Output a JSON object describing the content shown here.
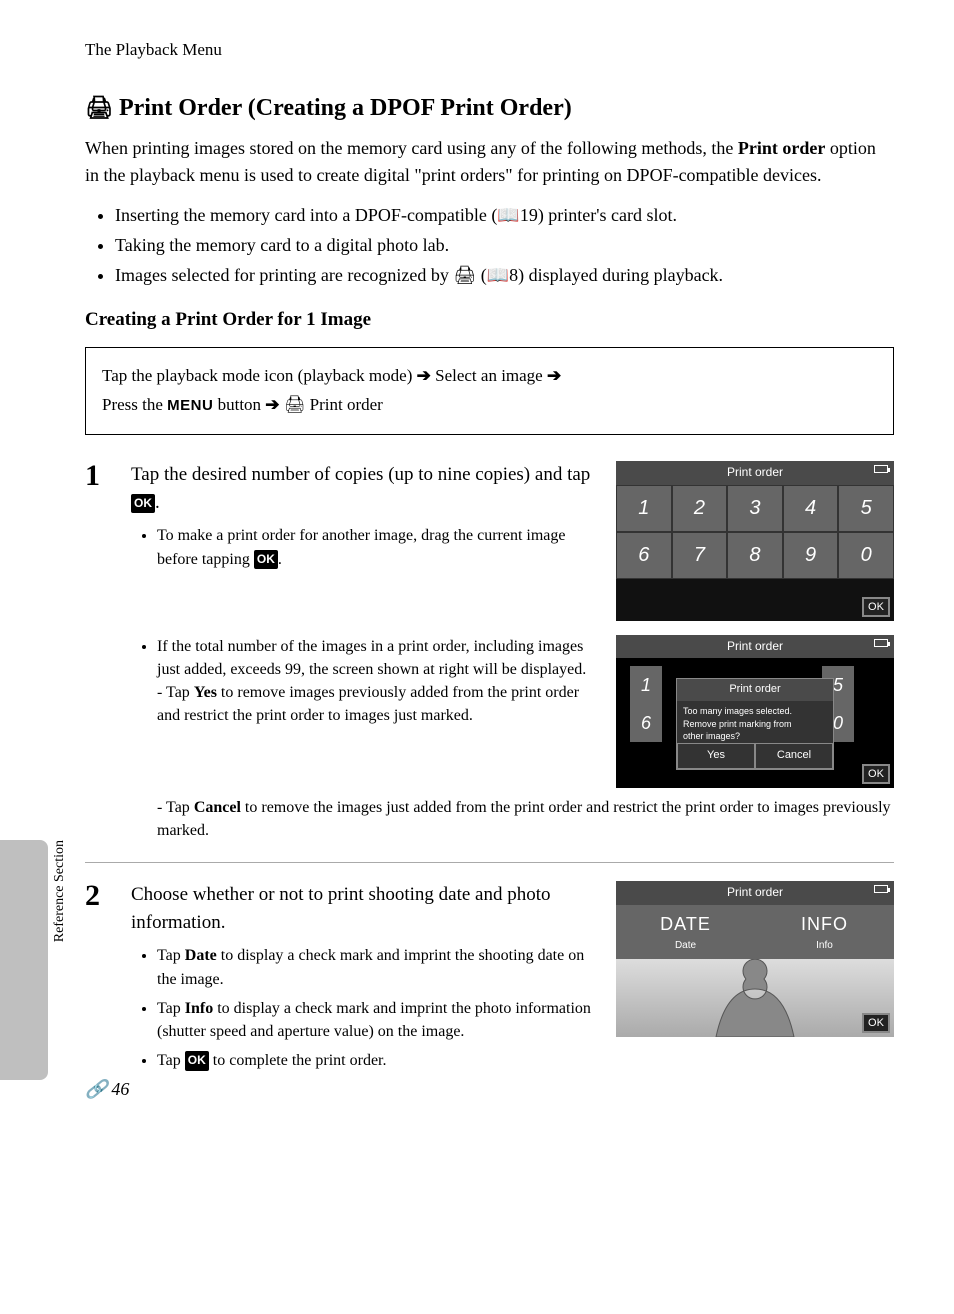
{
  "header": {
    "section": "The Playback Menu"
  },
  "title": "Print Order (Creating a DPOF Print Order)",
  "intro": {
    "part1": "When printing images stored on the memory card using any of the following methods, the ",
    "bold": "Print order",
    "part2": " option in the playback menu is used to create digital \"print orders\" for printing on DPOF-compatible devices."
  },
  "bullets": [
    "Inserting the memory card into a DPOF-compatible (📖19) printer's card slot.",
    "Taking the memory card to a digital photo lab.",
    "Images selected for printing are recognized by 🖨 (📖8) displayed during playback."
  ],
  "subhead": "Creating a Print Order for 1 Image",
  "navbox": {
    "l1a": "Tap the playback mode icon (playback mode) ",
    "l1b": " Select an image ",
    "l2a": "Press the ",
    "l2menu": "MENU",
    "l2b": " button ",
    "l2c": " 🖨 Print order"
  },
  "step1": {
    "head_a": "Tap the desired number of copies (up to nine copies) and tap ",
    "head_b": ".",
    "sub1": "To make a print order for another image, drag the current image before tapping ",
    "sub2": "If the total number of the images in a print order, including images just added, exceeds 99, the screen shown at right will be displayed.",
    "yes_a": "Tap ",
    "yes_b": "Yes",
    "yes_c": " to remove images previously added from the print order and restrict the print order to images just marked.",
    "cancel_a": "Tap ",
    "cancel_b": "Cancel",
    "cancel_c": " to remove the images just added from the print order and restrict the print order to images previously marked."
  },
  "step2": {
    "head": "Choose whether or not to print shooting date and photo information.",
    "b1a": "Tap ",
    "b1b": "Date",
    "b1c": " to display a check mark and imprint the shooting date on the image.",
    "b2a": "Tap ",
    "b2b": "Info",
    "b2c": " to display a check mark and imprint the photo information (shutter speed and aperture value) on the image.",
    "b3a": "Tap ",
    "b3b": " to complete the print order."
  },
  "screen1": {
    "title": "Print order",
    "keys": [
      "1",
      "2",
      "3",
      "4",
      "5",
      "6",
      "7",
      "8",
      "9",
      "0"
    ],
    "ok": "OK"
  },
  "screen2": {
    "title": "Print order",
    "dialog_title": "Print order",
    "msg1": "Too many images selected.",
    "msg2": "Remove print marking from",
    "msg3": "other images?",
    "yes": "Yes",
    "cancel": "Cancel",
    "k1": "1",
    "k5": "5",
    "k6": "6",
    "k0": "0",
    "ok": "OK"
  },
  "screen3": {
    "title": "Print order",
    "date_big": "DATE",
    "date_small": "Date",
    "info_big": "INFO",
    "info_small": "Info",
    "ok": "OK"
  },
  "side": "Reference Section",
  "pagenum": "46",
  "ok_glyph": "OK"
}
